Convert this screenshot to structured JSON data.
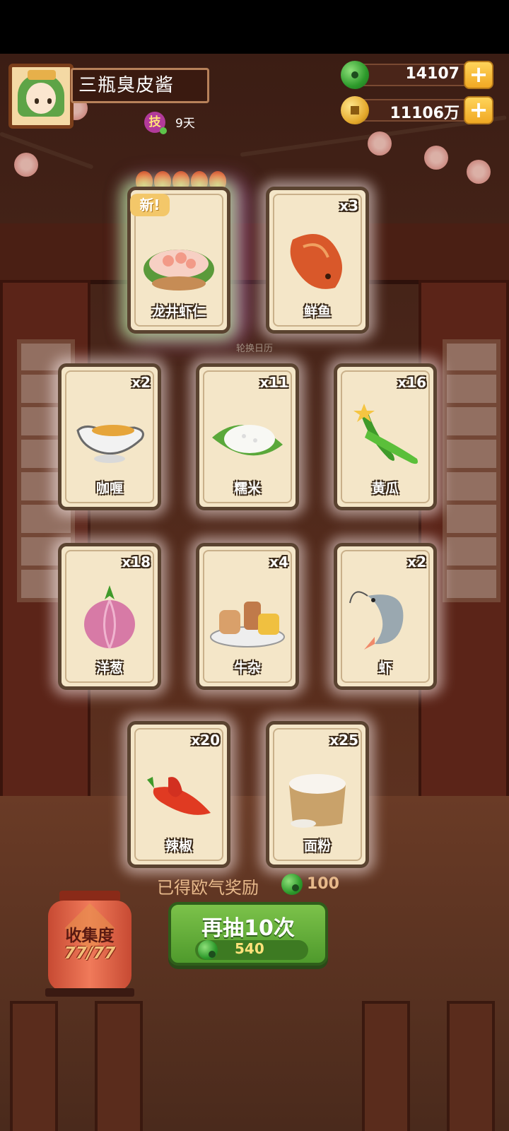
{
  "player": {
    "name": "三瓶臭皮酱",
    "skill_badge": "技",
    "days": "9天"
  },
  "currency": {
    "jade": "14107",
    "gold": "11106万"
  },
  "new_tag": "新!",
  "wheel_label": "轮换日历",
  "cards": [
    {
      "label": "龙井虾仁",
      "count": "",
      "is_new": true,
      "stars": 5
    },
    {
      "label": "鲜鱼",
      "count": "x3"
    },
    {
      "label": "咖喱",
      "count": "x2"
    },
    {
      "label": "糯米",
      "count": "x11"
    },
    {
      "label": "黄瓜",
      "count": "x16"
    },
    {
      "label": "洋葱",
      "count": "x18"
    },
    {
      "label": "牛杂",
      "count": "x4"
    },
    {
      "label": "虾",
      "count": "x2"
    },
    {
      "label": "辣椒",
      "count": "x20"
    },
    {
      "label": "面粉",
      "count": "x25"
    }
  ],
  "reward": {
    "label": "已得欧气奖励",
    "amount": "100"
  },
  "collection": {
    "title": "收集度",
    "progress": "77/77"
  },
  "draw_button": {
    "label": "再抽10次",
    "cost": "540"
  },
  "colors": {
    "jade": "#2d9a2b",
    "gold": "#e3a72a",
    "button_green": "#5fae36"
  }
}
